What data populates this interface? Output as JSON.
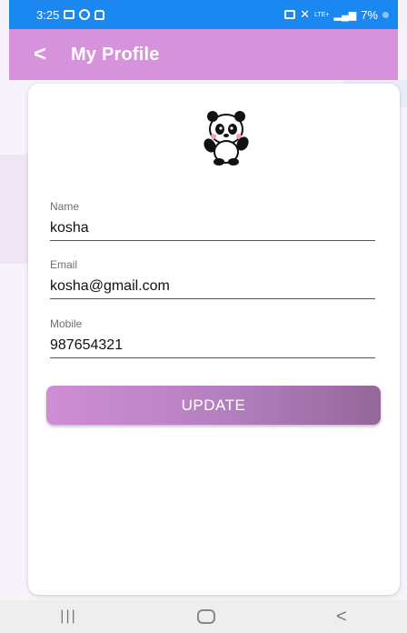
{
  "status": {
    "time": "3:25",
    "battery": "7%",
    "network": "LTE+"
  },
  "appbar": {
    "back": "<",
    "title": "My Profile"
  },
  "profile": {
    "name_label": "Name",
    "name_value": "kosha",
    "email_label": "Email",
    "email_value": "kosha@gmail.com",
    "mobile_label": "Mobile",
    "mobile_value": "987654321"
  },
  "actions": {
    "update": "UPDATE"
  },
  "navbar": {
    "recent": "|||",
    "home": "",
    "back": "<"
  },
  "colors": {
    "status_bar": "#1a88f0",
    "app_bar": "#d693db",
    "button_start": "#cf8ed4",
    "button_end": "#94679a"
  },
  "icons": {
    "avatar": "panda-icon"
  }
}
